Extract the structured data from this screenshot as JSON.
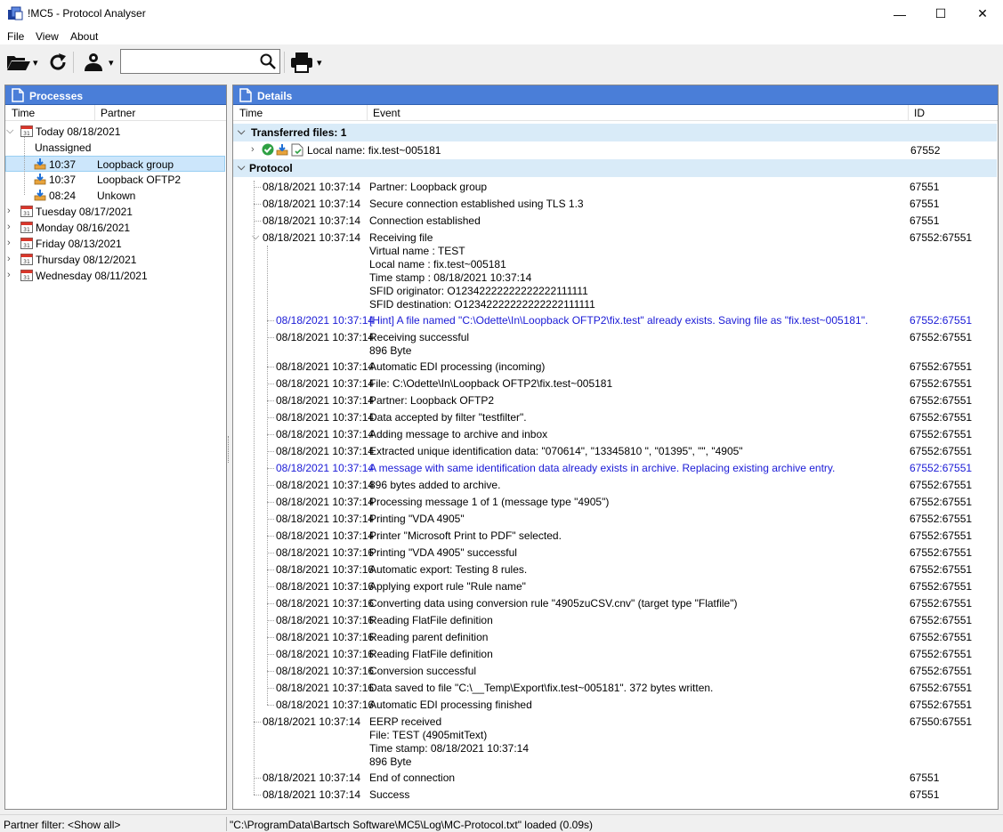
{
  "window": {
    "title": "!MC5 - Protocol Analyser",
    "minimize_glyph": "—",
    "maximize_glyph": "☐",
    "close_glyph": "✕"
  },
  "menu": {
    "items": [
      "File",
      "View",
      "About"
    ]
  },
  "toolbar": {
    "search_value": "",
    "icons": [
      "open-folder-icon",
      "refresh-icon",
      "user-icon",
      "search-icon",
      "print-icon"
    ],
    "dropdown_glyph": "▾"
  },
  "processes": {
    "header": "Processes",
    "col_time": "Time",
    "col_partner": "Partner",
    "today": "Today 08/18/2021",
    "unassigned": "Unassigned",
    "sessions": [
      {
        "time": "10:37",
        "partner": "Loopback group",
        "selected": true
      },
      {
        "time": "10:37",
        "partner": "Loopback OFTP2",
        "selected": false
      },
      {
        "time": "08:24",
        "partner": "Unkown",
        "selected": false
      }
    ],
    "days": [
      "Tuesday 08/17/2021",
      "Monday 08/16/2021",
      "Friday 08/13/2021",
      "Thursday 08/12/2021",
      "Wednesday 08/11/2021"
    ]
  },
  "details": {
    "header": "Details",
    "col_time": "Time",
    "col_event": "Event",
    "col_id": "ID",
    "transferred_title": "Transferred files: 1",
    "transferred_file": "Local name: fix.test~005181",
    "transferred_id": "67552",
    "protocol_title": "Protocol",
    "rows": [
      {
        "time": "08/18/2021 10:37:14",
        "lines": [
          "Partner: Loopback group"
        ],
        "id": "67551",
        "level": 1,
        "hint": false
      },
      {
        "time": "08/18/2021 10:37:14",
        "lines": [
          "Secure connection established using TLS 1.3"
        ],
        "id": "67551",
        "level": 1,
        "hint": false
      },
      {
        "time": "08/18/2021 10:37:14",
        "lines": [
          "Connection established"
        ],
        "id": "67551",
        "level": 1,
        "hint": false
      },
      {
        "time": "08/18/2021 10:37:14",
        "lines": [
          "Receiving file",
          "Virtual name : TEST",
          "Local name : fix.test~005181",
          "Time stamp : 08/18/2021 10:37:14",
          "SFID originator: O12342222222222222111111",
          "SFID destination: O12342222222222222111111"
        ],
        "id": "67552:67551",
        "level": 1,
        "hint": false,
        "expanded": true
      },
      {
        "time": "08/18/2021 10:37:14",
        "lines": [
          "[Hint] A file named \"C:\\Odette\\In\\Loopback OFTP2\\fix.test\" already exists. Saving file as \"fix.test~005181\"."
        ],
        "id": "67552:67551",
        "level": 2,
        "hint": true
      },
      {
        "time": "08/18/2021 10:37:14",
        "lines": [
          "Receiving successful",
          "896 Byte"
        ],
        "id": "67552:67551",
        "level": 2,
        "hint": false
      },
      {
        "time": "08/18/2021 10:37:14",
        "lines": [
          "Automatic EDI processing (incoming)"
        ],
        "id": "67552:67551",
        "level": 2,
        "hint": false
      },
      {
        "time": "08/18/2021 10:37:14",
        "lines": [
          "File: C:\\Odette\\In\\Loopback OFTP2\\fix.test~005181"
        ],
        "id": "67552:67551",
        "level": 2,
        "hint": false
      },
      {
        "time": "08/18/2021 10:37:14",
        "lines": [
          "Partner: Loopback OFTP2"
        ],
        "id": "67552:67551",
        "level": 2,
        "hint": false
      },
      {
        "time": "08/18/2021 10:37:14",
        "lines": [
          "Data accepted by filter \"testfilter\"."
        ],
        "id": "67552:67551",
        "level": 2,
        "hint": false
      },
      {
        "time": "08/18/2021 10:37:14",
        "lines": [
          "Adding message to archive and inbox"
        ],
        "id": "67552:67551",
        "level": 2,
        "hint": false
      },
      {
        "time": "08/18/2021 10:37:14",
        "lines": [
          "Extracted unique identification data: \"070614\", \"13345810 \", \"01395\", \"\", \"4905\""
        ],
        "id": "67552:67551",
        "level": 2,
        "hint": false
      },
      {
        "time": "08/18/2021 10:37:14",
        "lines": [
          "A message with same identification data already exists in archive. Replacing existing archive entry."
        ],
        "id": "67552:67551",
        "level": 2,
        "hint": true
      },
      {
        "time": "08/18/2021 10:37:14",
        "lines": [
          "896 bytes added to archive."
        ],
        "id": "67552:67551",
        "level": 2,
        "hint": false
      },
      {
        "time": "08/18/2021 10:37:14",
        "lines": [
          "Processing message 1 of 1 (message type \"4905\")"
        ],
        "id": "67552:67551",
        "level": 2,
        "hint": false
      },
      {
        "time": "08/18/2021 10:37:14",
        "lines": [
          "Printing \"VDA 4905\""
        ],
        "id": "67552:67551",
        "level": 2,
        "hint": false
      },
      {
        "time": "08/18/2021 10:37:14",
        "lines": [
          "Printer \"Microsoft Print to PDF\" selected."
        ],
        "id": "67552:67551",
        "level": 2,
        "hint": false
      },
      {
        "time": "08/18/2021 10:37:16",
        "lines": [
          "Printing \"VDA 4905\" successful"
        ],
        "id": "67552:67551",
        "level": 2,
        "hint": false
      },
      {
        "time": "08/18/2021 10:37:16",
        "lines": [
          "Automatic export: Testing 8 rules."
        ],
        "id": "67552:67551",
        "level": 2,
        "hint": false
      },
      {
        "time": "08/18/2021 10:37:16",
        "lines": [
          "Applying export rule \"Rule name\""
        ],
        "id": "67552:67551",
        "level": 2,
        "hint": false
      },
      {
        "time": "08/18/2021 10:37:16",
        "lines": [
          "Converting data using conversion rule \"4905zuCSV.cnv\" (target type \"Flatfile\")"
        ],
        "id": "67552:67551",
        "level": 2,
        "hint": false
      },
      {
        "time": "08/18/2021 10:37:16",
        "lines": [
          "Reading FlatFile definition"
        ],
        "id": "67552:67551",
        "level": 2,
        "hint": false
      },
      {
        "time": "08/18/2021 10:37:16",
        "lines": [
          "Reading parent definition"
        ],
        "id": "67552:67551",
        "level": 2,
        "hint": false
      },
      {
        "time": "08/18/2021 10:37:16",
        "lines": [
          "Reading FlatFile definition"
        ],
        "id": "67552:67551",
        "level": 2,
        "hint": false
      },
      {
        "time": "08/18/2021 10:37:16",
        "lines": [
          "Conversion successful"
        ],
        "id": "67552:67551",
        "level": 2,
        "hint": false
      },
      {
        "time": "08/18/2021 10:37:16",
        "lines": [
          "Data saved to file \"C:\\__Temp\\Export\\fix.test~005181\". 372 bytes written."
        ],
        "id": "67552:67551",
        "level": 2,
        "hint": false
      },
      {
        "time": "08/18/2021 10:37:16",
        "lines": [
          "Automatic EDI processing finished"
        ],
        "id": "67552:67551",
        "level": 2,
        "hint": false
      },
      {
        "time": "08/18/2021 10:37:14",
        "lines": [
          "EERP received",
          "File: TEST (4905mitText)",
          "Time stamp: 08/18/2021 10:37:14",
          "896 Byte"
        ],
        "id": "67550:67551",
        "level": 1,
        "hint": false
      },
      {
        "time": "08/18/2021 10:37:14",
        "lines": [
          "End of connection"
        ],
        "id": "67551",
        "level": 1,
        "hint": false
      },
      {
        "time": "08/18/2021 10:37:14",
        "lines": [
          "Success"
        ],
        "id": "67551",
        "level": 1,
        "hint": false
      }
    ]
  },
  "status": {
    "left": "Partner filter: <Show all>",
    "right": "\"C:\\ProgramData\\Bartsch Software\\MC5\\Log\\MC-Protocol.txt\" loaded (0.09s)"
  }
}
